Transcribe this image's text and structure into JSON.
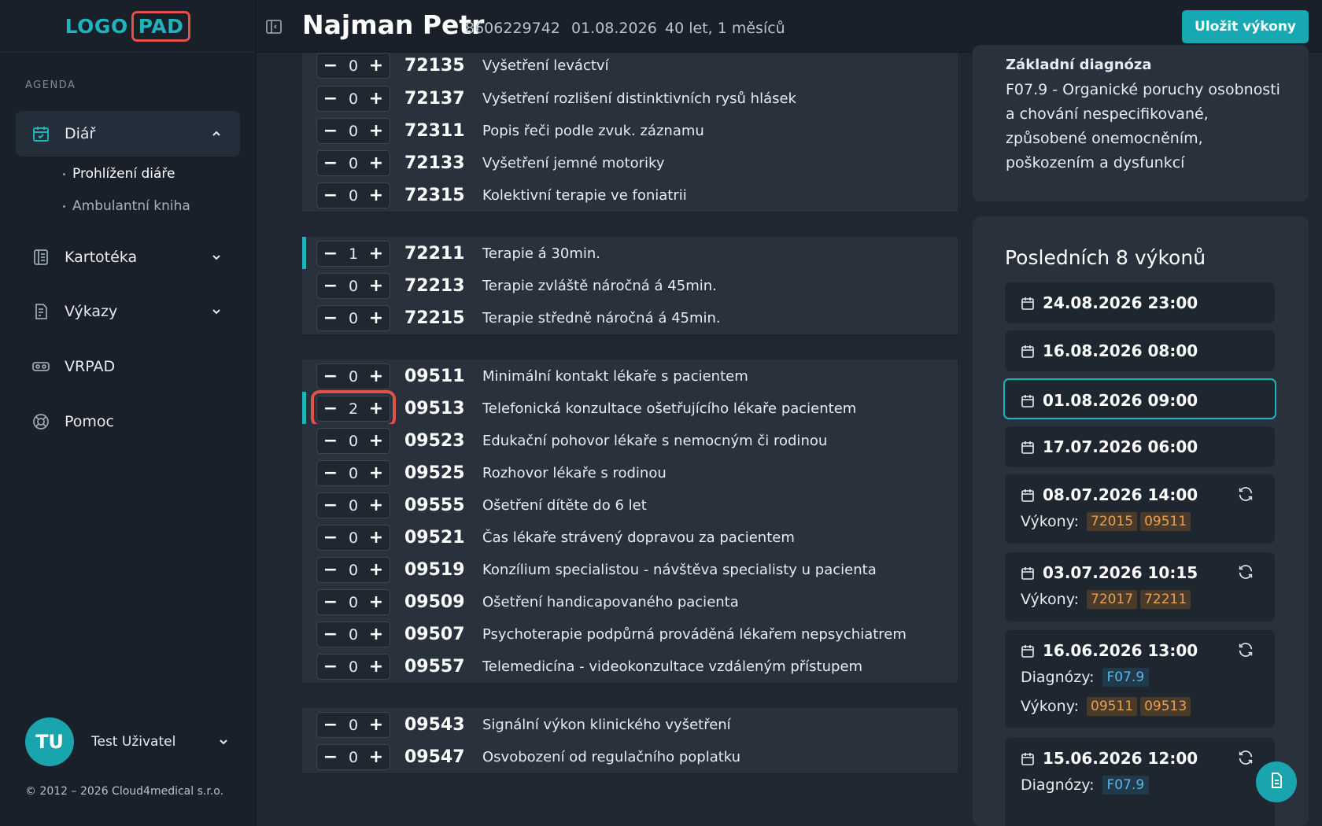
{
  "app": {
    "logo_part1": "LOGO",
    "logo_part2": "PAD",
    "accent_color": "#1fb3bc",
    "logo_frame_color": "#e0524a"
  },
  "sidebar": {
    "section_label": "AGENDA",
    "items": [
      {
        "label": "Diář",
        "icon": "calendar-check-icon",
        "expanded": true
      },
      {
        "label": "Kartotéka",
        "icon": "card-file-icon"
      },
      {
        "label": "Výkazy",
        "icon": "report-icon"
      },
      {
        "label": "VRPAD",
        "icon": "vr-headset-icon"
      },
      {
        "label": "Pomoc",
        "icon": "lifebuoy-icon"
      }
    ],
    "sub_items": [
      {
        "label": "Prohlížení diáře"
      },
      {
        "label": "Ambulantní kniha"
      }
    ],
    "user": {
      "initials": "TU",
      "name": "Test Uživatel"
    },
    "copyright": "© 2012 – 2026 Cloud4medical s.r.o."
  },
  "header": {
    "patient_name": "Najman Petr",
    "patient_id": "8606229742",
    "visit_date": "01.08.2026",
    "age": "40 let, 1 měsíců",
    "save_label": "Uložit výkony"
  },
  "procedures": [
    {
      "qty": "0",
      "code": "72135",
      "desc": "Vyšetření leváctví"
    },
    {
      "qty": "0",
      "code": "72137",
      "desc": "Vyšetření rozlišení distinktivních rysů hlásek"
    },
    {
      "qty": "0",
      "code": "72311",
      "desc": "Popis řeči podle zvuk. záznamu"
    },
    {
      "qty": "0",
      "code": "72133",
      "desc": "Vyšetření jemné motoriky"
    },
    {
      "qty": "0",
      "code": "72315",
      "desc": "Kolektivní terapie ve foniatrii"
    },
    {
      "qty": "1",
      "code": "72211",
      "desc": "Terapie á 30min."
    },
    {
      "qty": "0",
      "code": "72213",
      "desc": "Terapie zvláště náročná á 45min."
    },
    {
      "qty": "0",
      "code": "72215",
      "desc": "Terapie středně náročná á 45min."
    },
    {
      "qty": "0",
      "code": "09511",
      "desc": "Minimální kontakt lékaře s pacientem"
    },
    {
      "qty": "2",
      "code": "09513",
      "desc": "Telefonická konzultace ošetřujícího lékaře pacientem"
    },
    {
      "qty": "0",
      "code": "09523",
      "desc": "Edukační pohovor lékaře s nemocným či rodinou"
    },
    {
      "qty": "0",
      "code": "09525",
      "desc": "Rozhovor lékaře s rodinou"
    },
    {
      "qty": "0",
      "code": "09555",
      "desc": "Ošetření dítěte do 6 let"
    },
    {
      "qty": "0",
      "code": "09521",
      "desc": "Čas lékaře strávený dopravou za pacientem"
    },
    {
      "qty": "0",
      "code": "09519",
      "desc": "Konzílium specialistou - návštěva specialisty u pacienta"
    },
    {
      "qty": "0",
      "code": "09509",
      "desc": "Ošetření handicapovaného pacienta"
    },
    {
      "qty": "0",
      "code": "09507",
      "desc": "Psychoterapie podpůrná prováděná lékařem nepsychiatrem"
    },
    {
      "qty": "0",
      "code": "09557",
      "desc": "Telemedicína - videokonzultace vzdáleným přístupem"
    },
    {
      "qty": "0",
      "code": "09543",
      "desc": "Signální výkon klinického vyšetření"
    },
    {
      "qty": "0",
      "code": "09547",
      "desc": "Osvobození od regulačního poplatku"
    }
  ],
  "stepper": {
    "minus": "−",
    "plus": "+"
  },
  "diagnosis": {
    "title": "Základní diagnóza",
    "text": "F07.9 - Organické poruchy osobnosti a chování nespecifikované, způsobené onemocněním, poškozením a dysfunkcí"
  },
  "recent": {
    "title": "Posledních 8 výkonů",
    "procedures_label": "Výkony:",
    "diagnoses_label": "Diagnózy:",
    "visits": [
      {
        "datetime": "24.08.2026 23:00"
      },
      {
        "datetime": "16.08.2026 08:00"
      },
      {
        "datetime": "01.08.2026 09:00",
        "active": true
      },
      {
        "datetime": "17.07.2026 06:00"
      },
      {
        "datetime": "08.07.2026 14:00",
        "procedures": [
          "72015",
          "09511"
        ]
      },
      {
        "datetime": "03.07.2026 10:15",
        "procedures": [
          "72017",
          "72211"
        ]
      },
      {
        "datetime": "16.06.2026 13:00",
        "diagnoses": [
          "F07.9"
        ],
        "procedures": [
          "09511",
          "09513"
        ]
      },
      {
        "datetime": "15.06.2026 12:00",
        "diagnoses": [
          "F07.9"
        ]
      }
    ]
  }
}
